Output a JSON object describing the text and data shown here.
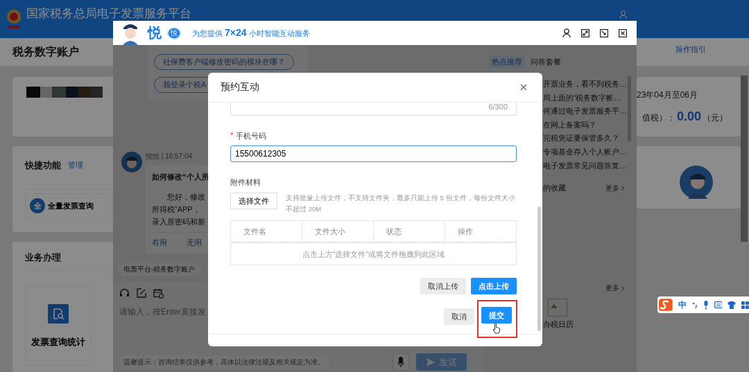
{
  "page": {
    "title": "国家税务总局电子发票服务平台",
    "account_title": "税务数字账户",
    "guide_link": "操作指引",
    "shortcuts": {
      "title": "快捷功能",
      "manage": "管理",
      "items": [
        {
          "badge": "全",
          "label": "全量发票查询"
        }
      ]
    },
    "business": {
      "title": "业务办理",
      "tiles": [
        {
          "label": "发票查询统计"
        }
      ]
    },
    "summary": {
      "period": "23年04月至06月",
      "tax_label": "值税）：",
      "amount": "0.00",
      "unit": "（元）"
    }
  },
  "chat": {
    "brand": "悦",
    "badge": "悦",
    "tagline": "为您提供 **7×24** 小时智能互动服务",
    "suggestions": [
      "社保费客户端修改密码的模块在哪？",
      "我登录个税A"
    ],
    "message": {
      "sender": "悦悦 | 16:57:04",
      "question": "如何修改“个人所",
      "lines": [
        "您好，修改",
        "所得税”APP，",
        "录入原密码和新"
      ],
      "actions": [
        "有用",
        "无用"
      ]
    },
    "context_tag": "电票平台-税务数字账户",
    "input": {
      "placeholder": "请输入，按Enter直接发"
    },
    "notice": "温馨提示：咨询结果仅供参考，具体以法律法规及相关规定为准。",
    "send": "发送",
    "tabs": [
      {
        "label": "热点推荐",
        "selected": true
      },
      {
        "label": "问答套餐",
        "selected": false
      }
    ],
    "hot_questions": [
      "开票业务，看不到税务…",
      "局上面的“税务数字帐…",
      "何通过电子发票服务平…",
      "在网上备案吗？",
      "完税凭证要保管多久？",
      "专项基金存入个人帐户…",
      "电子发票常见问题答复…"
    ],
    "favorites": {
      "title": "的收藏",
      "more": "更多"
    },
    "tools": {
      "more": "更多",
      "items": [
        {
          "label": "办税日历"
        }
      ]
    }
  },
  "modal": {
    "title": "预约互动",
    "counter": "6/300",
    "phone": {
      "required_mark": "*",
      "label": "手机号码",
      "value": "15500612305"
    },
    "attachments": {
      "label": "附件材料",
      "choose": "选择文件",
      "hint": "支持批量上传文件，不支持文件夹，最多只能上传 5 份文件，每份文件大小不超过 20M",
      "columns": [
        "文件名",
        "文件大小",
        "状态",
        "操作"
      ],
      "empty": "点击上方“选择文件”或将文件拖拽到此区域",
      "cancel_upload": "取消上传",
      "upload": "点击上传"
    },
    "buttons": [
      {
        "label": "取消",
        "kind": "default",
        "highlighted": false
      },
      {
        "label": "提交",
        "kind": "primary",
        "highlighted": true
      }
    ]
  },
  "ime": {
    "mode": "中"
  }
}
